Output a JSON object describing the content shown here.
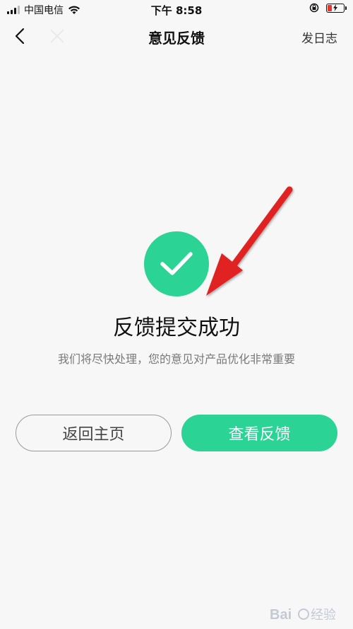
{
  "status_bar": {
    "carrier": "中国电信",
    "time": "下午 8:58"
  },
  "nav": {
    "title": "意见反馈",
    "log_label": "发日志"
  },
  "result": {
    "title": "反馈提交成功",
    "description": "我们将尽快处理，您的意见对产品优化非常重要"
  },
  "buttons": {
    "home_label": "返回主页",
    "view_label": "查看反馈"
  },
  "colors": {
    "accent": "#2bd395",
    "background": "#f7f7f7",
    "annotation_arrow": "#e02020"
  },
  "icons": {
    "back": "chevron-left-icon",
    "close": "close-icon",
    "success": "checkmark-icon"
  }
}
